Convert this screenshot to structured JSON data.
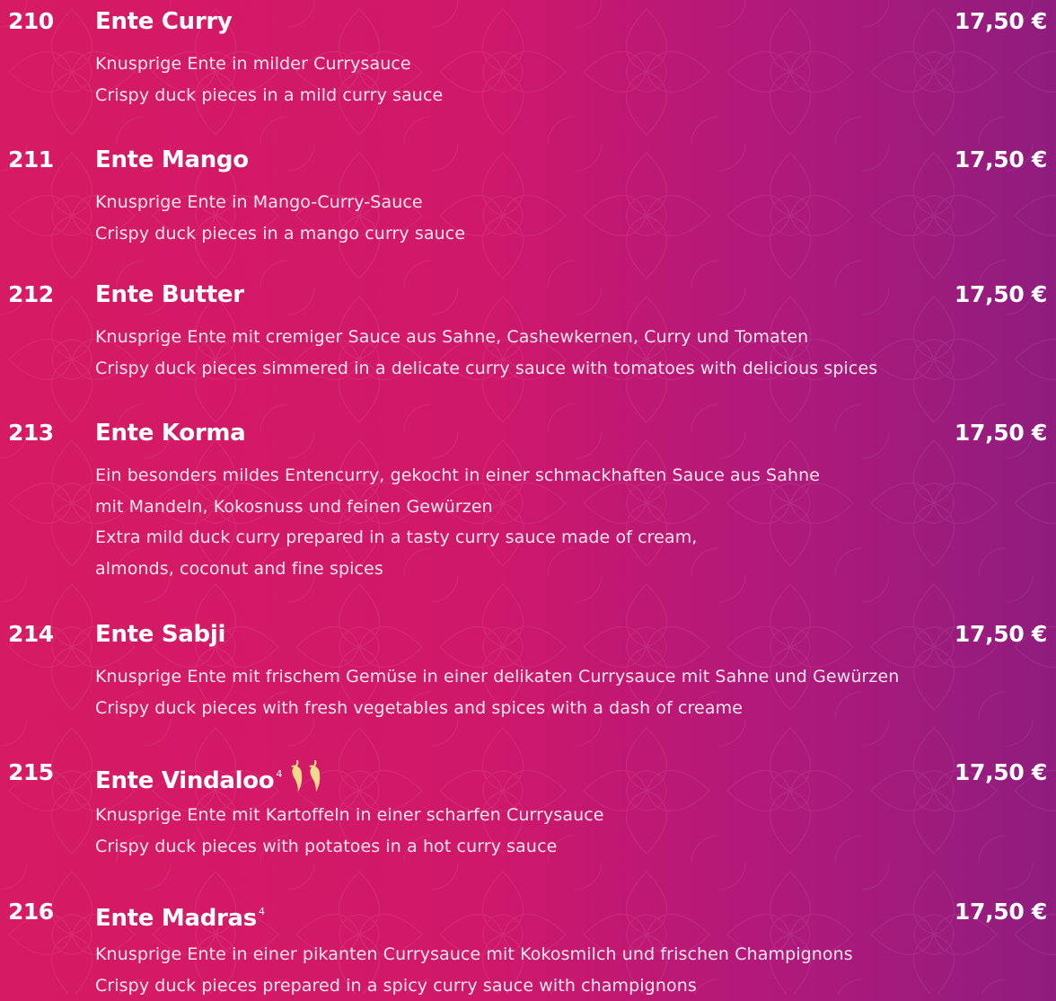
{
  "colors": {
    "background_left": "#d61a63",
    "background_right": "#8f1d7e",
    "text": "#ffffff",
    "chili": "#f3d98a"
  },
  "items": [
    {
      "number": "210",
      "name": "Ente Curry",
      "price": "17,50 €",
      "lines": [
        "Knusprige Ente in milder Currysauce",
        "Crispy duck pieces in a mild curry sauce"
      ]
    },
    {
      "number": "211",
      "name": "Ente Mango",
      "price": "17,50 €",
      "lines": [
        "Knusprige Ente in Mango-Curry-Sauce",
        "Crispy duck pieces in a mango curry sauce"
      ]
    },
    {
      "number": "212",
      "name": "Ente Butter",
      "price": "17,50 €",
      "lines": [
        "Knusprige Ente mit cremiger Sauce aus Sahne, Cashewkernen, Curry und Tomaten",
        "Crispy duck pieces simmered in a delicate curry sauce with tomatoes with delicious spices"
      ]
    },
    {
      "number": "213",
      "name": "Ente Korma",
      "price": "17,50 €",
      "lines": [
        "Ein besonders mildes Entencurry, gekocht in einer schmackhaften Sauce aus Sahne",
        "mit Mandeln, Kokosnuss und feinen Gewürzen",
        "Extra mild duck curry prepared in a tasty curry sauce made of cream,",
        "almonds, coconut and fine spices"
      ]
    },
    {
      "number": "214",
      "name": "Ente Sabji",
      "price": "17,50 €",
      "lines": [
        "Knusprige Ente mit frischem Gemüse in einer delikaten Currysauce mit Sahne und Gewürzen",
        "Crispy duck pieces with fresh vegetables and spices with a dash of creame"
      ]
    },
    {
      "number": "215",
      "name": "Ente Vindaloo",
      "sup": "4",
      "chili_count": 2,
      "price": "17,50 €",
      "lines": [
        "Knusprige Ente mit Kartoffeln in einer scharfen Currysauce",
        "Crispy duck pieces with potatoes in a hot curry sauce"
      ]
    },
    {
      "number": "216",
      "name": "Ente Madras",
      "sup": "4",
      "price": "17,50 €",
      "lines": [
        "Knusprige Ente in einer pikanten Currysauce mit Kokosmilch und frischen Champignons",
        "Crispy duck pieces prepared in a spicy curry sauce with champignons"
      ]
    }
  ]
}
